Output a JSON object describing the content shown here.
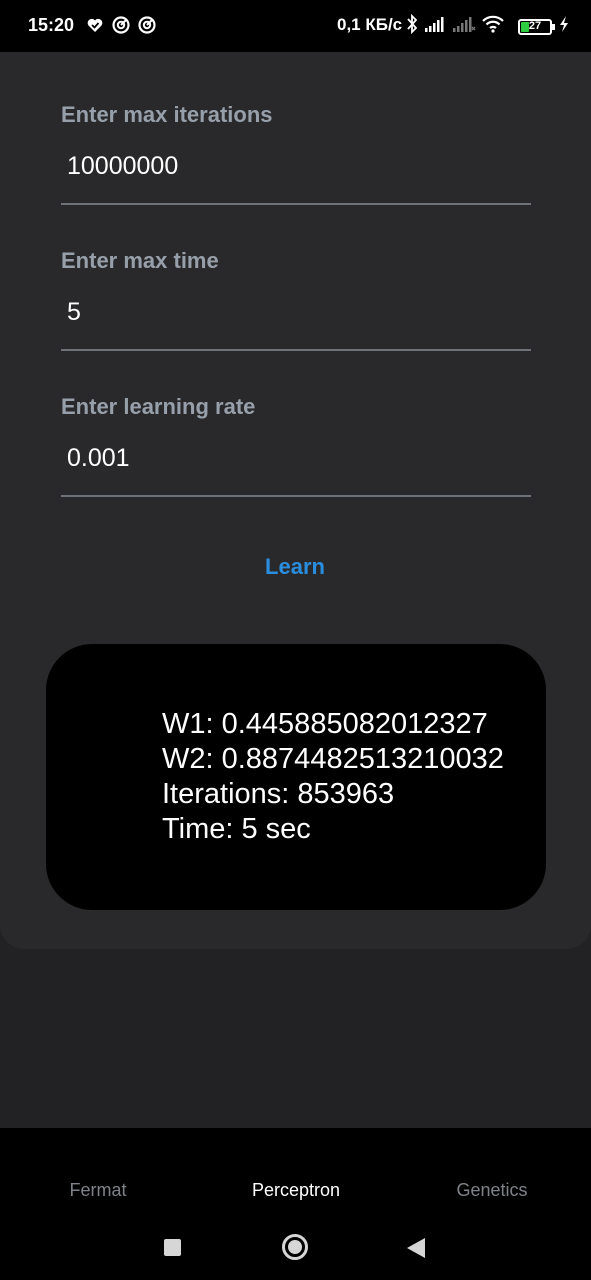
{
  "status_bar": {
    "time": "15:20",
    "left_icons": [
      "heart-shield-icon",
      "notification-circle-icon",
      "notification-circle-icon"
    ],
    "network_speed": "0,1 КБ/с",
    "right_icons": [
      "bluetooth-icon",
      "signal-icon",
      "signal-empty-icon",
      "wifi-icon"
    ],
    "battery_level": "27",
    "charging_icon": "lightning-icon"
  },
  "form": {
    "max_iterations": {
      "label": "Enter max iterations",
      "value": "10000000"
    },
    "max_time": {
      "label": "Enter max time",
      "value": "5"
    },
    "learning_rate": {
      "label": "Enter learning rate",
      "value": "0.001"
    },
    "learn_label": "Learn"
  },
  "result": {
    "w1": "W1: 0.445885082012327",
    "w2": "W2: 0.8874482513210032",
    "iterations": "Iterations: 853963",
    "time": "Time: 5 sec"
  },
  "bottom_nav": {
    "tabs": [
      {
        "label": "Fermat",
        "active": false
      },
      {
        "label": "Perceptron",
        "active": true
      },
      {
        "label": "Genetics",
        "active": false
      }
    ]
  },
  "system_nav": {
    "icons": [
      "recents-square-icon",
      "home-circle-icon",
      "back-triangle-icon"
    ]
  },
  "colors": {
    "accent": "#2a8ee0",
    "label": "#97a0aa",
    "background": "#222224",
    "card": "#000000",
    "battery": "#2ecc40"
  }
}
